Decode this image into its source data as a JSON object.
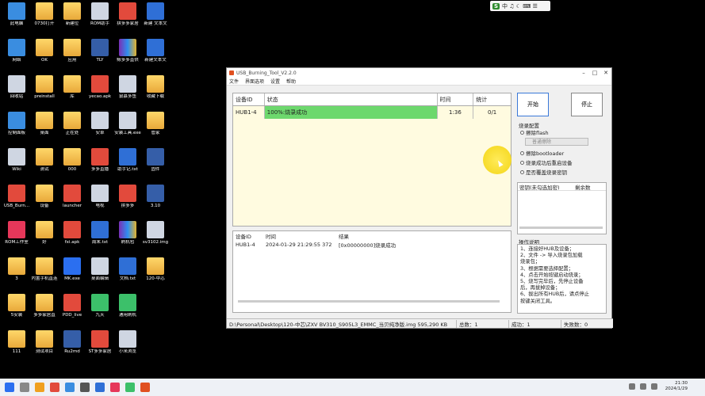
{
  "desktop": {
    "icons": [
      {
        "label": "此电脑"
      },
      {
        "label": "0730打开"
      },
      {
        "label": "新建位"
      },
      {
        "label": "ROM助手"
      },
      {
        "label": "拼多多家居"
      },
      {
        "label": "新建 文本文"
      },
      {
        "label": "网络"
      },
      {
        "label": "OK"
      },
      {
        "label": "应用"
      },
      {
        "label": "TLY"
      },
      {
        "label": "鲸多多直供"
      },
      {
        "label": "新建文本文"
      },
      {
        "label": "回收站"
      },
      {
        "label": "preinstall"
      },
      {
        "label": "库"
      },
      {
        "label": "yecao.apk"
      },
      {
        "label": "鼠慕多鱼"
      },
      {
        "label": "收藏下载"
      },
      {
        "label": "控制面板"
      },
      {
        "label": "桌面"
      },
      {
        "label": "正在处"
      },
      {
        "label": "安卓"
      },
      {
        "label": "安装工具.exe"
      },
      {
        "label": "管家"
      },
      {
        "label": "Wiki"
      },
      {
        "label": "测试"
      },
      {
        "label": "000"
      },
      {
        "label": "多多直播"
      },
      {
        "label": "助手记.txt"
      },
      {
        "label": "固件"
      },
      {
        "label": "USB_Burn..."
      },
      {
        "label": "设备"
      },
      {
        "label": "launcher"
      },
      {
        "label": "电视"
      },
      {
        "label": "拼多多"
      },
      {
        "label": "3.10"
      },
      {
        "label": "ROM工作室"
      },
      {
        "label": "好"
      },
      {
        "label": "fxi.apk"
      },
      {
        "label": "周末.txt"
      },
      {
        "label": "刷机包"
      },
      {
        "label": "sv3102.img"
      },
      {
        "label": "3"
      },
      {
        "label": "内置手机直连"
      },
      {
        "label": "MK.exe"
      },
      {
        "label": "桌面编辑"
      },
      {
        "label": "文档.txt"
      },
      {
        "label": "120-中芯"
      },
      {
        "label": "5安装"
      },
      {
        "label": "多多家居直"
      },
      {
        "label": "PDD_live"
      },
      {
        "label": "九天"
      },
      {
        "label": "通用刷机"
      },
      {
        "label": "111"
      },
      {
        "label": "测试项目"
      },
      {
        "label": "Ru2md"
      },
      {
        "label": "ST多多家居"
      },
      {
        "label": "小米浏览"
      }
    ]
  },
  "tray_widget": {
    "logo": "S",
    "items": "中 ♫ ☾ ⌨ ☰"
  },
  "window": {
    "title": "USB_Burning_Tool_V2.2.0",
    "menu": [
      "文件",
      "界面选项",
      "设置",
      "帮助"
    ],
    "table": {
      "headers": [
        "设备ID",
        "状态",
        "时间",
        "统计"
      ],
      "rows": [
        {
          "id": "HUB1-4",
          "status": "100%:烧录成功",
          "time": "1:36",
          "stat": "0/1"
        }
      ]
    },
    "log": {
      "headers": [
        "设备ID",
        "时间",
        "结果"
      ],
      "rows": [
        {
          "id": "HUB1-4",
          "time": "2024-01-29 21:29:55 372",
          "result": "[0x00000000]烧录成功"
        }
      ]
    },
    "status_bar": {
      "path": "D:\\Personal\\Desktop\\120-中芯\\ZXV BV310_S905L3_EMMC_当贝纯净版.img 595,290 KB",
      "total": "总数：1",
      "success": "成功：1",
      "fail": "失败数：0"
    },
    "buttons": {
      "start": "开始",
      "stop": "停止"
    },
    "config": {
      "title": "烧录配置",
      "erase_flash": "擦除flash",
      "select_placeholder": "普通擦除",
      "erase_bootloader": "擦除bootloader",
      "reset_after": "烧录成功后重启设备",
      "overwrite_key": "是否覆盖烧录密钥"
    },
    "key_list": {
      "col1": "密钥(未勾选加密)",
      "col2": "剩余数"
    },
    "guide": {
      "title": "操作说明",
      "lines": [
        "1、连接好HUB及设备；",
        "2、文件 -> 导入烧录包加载",
        "   烧录包；",
        "3、根据需要选择配置；",
        "4、点击开始按键启动烧录；",
        "5、烧写完毕后，先停止设备",
        "   后，再拔掉设备；",
        "6、拔出所有HUB后，请点停止",
        "   按键关闭工具。"
      ]
    }
  },
  "taskbar": {
    "time": "21:30",
    "date": "2024/1/29"
  }
}
